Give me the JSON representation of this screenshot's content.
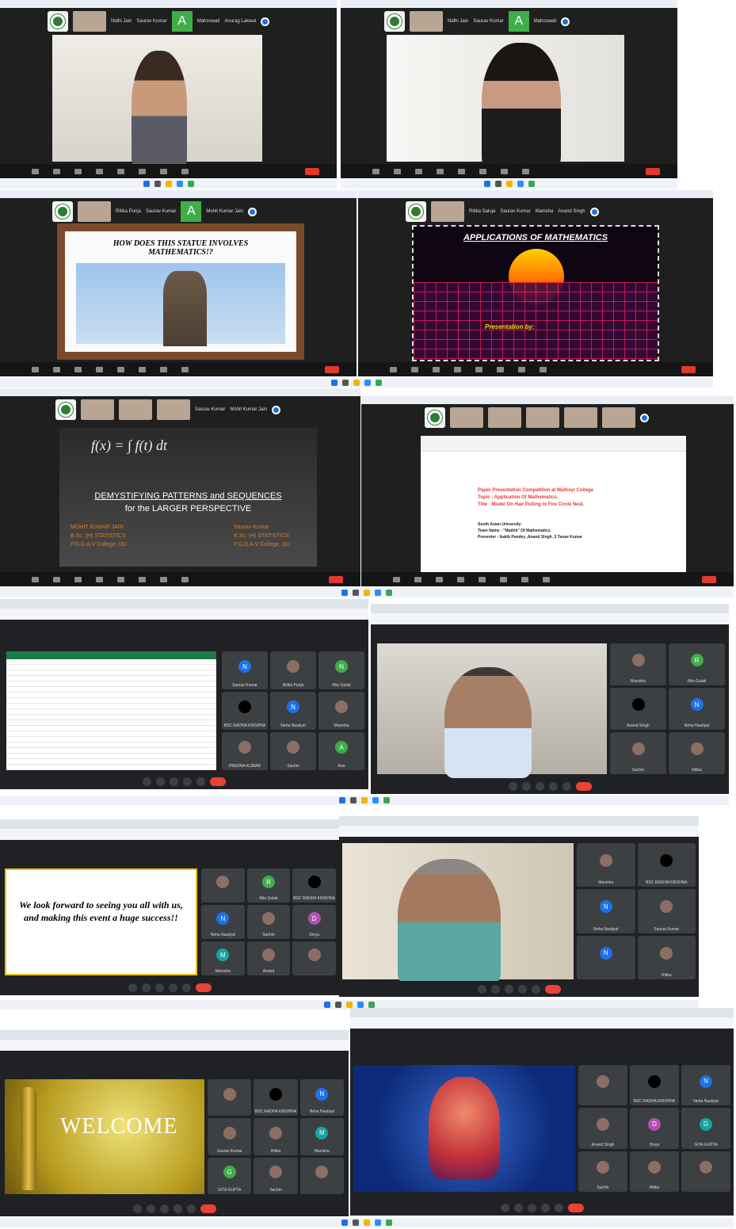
{
  "panel1": {
    "participants": [
      "Nidhi Jain",
      "Saurav Kumar",
      "A",
      "Mahoswati",
      "Anurag Lakwal"
    ]
  },
  "panel2": {
    "participants": [
      "Nidhi Jain",
      "Saurav Kumar",
      "A",
      "Mahoswati"
    ]
  },
  "panel3": {
    "participants": [
      "Ritika Punja",
      "Saurav Kumar",
      "A",
      "Mohit Kumar Jain"
    ],
    "slide": {
      "title": "HOW DOES THIS STATUE  INVOLVES MATHEMATICS!?"
    }
  },
  "panel4": {
    "participants": [
      "Ritika Saluja",
      "Saurav Kumar",
      "Manisha",
      "Anand Singh"
    ],
    "slide": {
      "title": "APPLICATIONS OF MATHEMATICS",
      "byline": "Presentation by:"
    }
  },
  "panel5": {
    "participants": [
      "Saurav Kumar",
      "Mohit Kumar Jain"
    ],
    "slide": {
      "formula": "f(x) = ∫ f(t) dt",
      "title1": "DEMYSTIFYING PATTERNS and SEQUENCES",
      "title2": "for the LARGER PERSPECTIVE",
      "left": [
        "MOHIT KUMAR JAIN",
        "B.Sc. (H) STATISTICS",
        "P.G.D.A.V College, DU"
      ],
      "right": [
        "Saurav Kumar",
        "B.Sc. (H) STATISTICS",
        "P.G.D.A.V College, DU"
      ]
    }
  },
  "panel6": {
    "doc": {
      "line1": "Paper Presentation Competition at Maitreyi College",
      "line2": "Topic :  Application Of Mathematics.",
      "line3": "Title :  Model On Hair Pulling to Fire Circle Nest.",
      "inst": "South Asian University",
      "team": "Team Name :  \"Mathik\" Of Mathematics.",
      "presenter": "Presenter :  Aakib Pandey ,Anand Singh ,3 Tanav Kumar"
    }
  },
  "panel7": {
    "tiles": [
      {
        "n": "N",
        "name": "Saurav Kumar",
        "c": "#1a73e8"
      },
      {
        "n": "",
        "name": "Ritika Punja",
        "c": ""
      },
      {
        "n": "N",
        "name": "Ritu Gulati",
        "c": "#3fae49"
      },
      {
        "n": "",
        "name": "BSC RADHA KRISHNA",
        "c": "#000"
      },
      {
        "n": "N",
        "name": "Neha Nautiyal",
        "c": "#1a73e8"
      },
      {
        "n": "",
        "name": "Manisha",
        "c": ""
      },
      {
        "n": "",
        "name": "PRERNA KUMAR",
        "c": ""
      },
      {
        "n": "",
        "name": "Sachin",
        "c": ""
      },
      {
        "n": "A",
        "name": "Anu",
        "c": "#3fae49"
      }
    ]
  },
  "panel8": {
    "tiles": [
      {
        "n": "",
        "name": "Manisha",
        "c": ""
      },
      {
        "n": "R",
        "name": "Ritu Gulati",
        "c": "#3fae49"
      },
      {
        "n": "",
        "name": "Anand Singh",
        "c": "#000"
      },
      {
        "n": "N",
        "name": "Neha Nautiyal",
        "c": "#1a73e8"
      },
      {
        "n": "",
        "name": "Sachin",
        "c": ""
      },
      {
        "n": "",
        "name": "Ritika",
        "c": ""
      }
    ]
  },
  "panel9": {
    "message": "We look forward to seeing you all with us, and making this event a huge success!!",
    "tiles": [
      {
        "n": "",
        "name": "",
        "c": ""
      },
      {
        "n": "R",
        "name": "Ritu Gulati",
        "c": "#3fae49"
      },
      {
        "n": "",
        "name": "BSC RADHA KRISHNA",
        "c": "#000"
      },
      {
        "n": "N",
        "name": "Neha Nautiyal",
        "c": "#1a73e8"
      },
      {
        "n": "",
        "name": "Sachin",
        "c": ""
      },
      {
        "n": "D",
        "name": "Divya",
        "c": "#b44fb4"
      },
      {
        "n": "M",
        "name": "Manisha",
        "c": "#19a3a3"
      },
      {
        "n": "",
        "name": "Anand",
        "c": ""
      },
      {
        "n": "",
        "name": "",
        "c": ""
      }
    ]
  },
  "panel10": {
    "tiles": [
      {
        "n": "",
        "name": "Manisha",
        "c": ""
      },
      {
        "n": "",
        "name": "BSC RADHA KRISHNA",
        "c": "#000"
      },
      {
        "n": "N",
        "name": "Neha Nautiyal",
        "c": "#1a73e8"
      },
      {
        "n": "",
        "name": "Saurav Kumar",
        "c": ""
      },
      {
        "n": "N",
        "name": "",
        "c": "#1a73e8"
      },
      {
        "n": "",
        "name": "Ritika",
        "c": ""
      }
    ]
  },
  "panel11": {
    "slide": {
      "title": "WELCOME"
    },
    "tiles": [
      {
        "n": "",
        "name": "",
        "c": ""
      },
      {
        "n": "",
        "name": "BSC RADHA KRISHNA",
        "c": "#000"
      },
      {
        "n": "N",
        "name": "Neha Nautiyal",
        "c": "#1a73e8"
      },
      {
        "n": "",
        "name": "Saurav Kumar",
        "c": ""
      },
      {
        "n": "",
        "name": "Ritika",
        "c": ""
      },
      {
        "n": "M",
        "name": "Manisha",
        "c": "#19a3a3"
      },
      {
        "n": "G",
        "name": "GITA GUPTA",
        "c": "#3fae49"
      },
      {
        "n": "",
        "name": "Sachin",
        "c": ""
      },
      {
        "n": "",
        "name": "",
        "c": ""
      }
    ]
  },
  "panel12": {
    "tiles": [
      {
        "n": "",
        "name": "",
        "c": ""
      },
      {
        "n": "",
        "name": "BSC RADHA KRISHNA",
        "c": "#000"
      },
      {
        "n": "N",
        "name": "Neha Nautiyal",
        "c": "#1a73e8"
      },
      {
        "n": "",
        "name": "Anand Singh",
        "c": ""
      },
      {
        "n": "D",
        "name": "Divya",
        "c": "#b44fb4"
      },
      {
        "n": "G",
        "name": "GITA GUPTA",
        "c": "#19a3a3"
      },
      {
        "n": "",
        "name": "Sachin",
        "c": ""
      },
      {
        "n": "",
        "name": "Ritika",
        "c": ""
      },
      {
        "n": "",
        "name": "",
        "c": ""
      }
    ]
  }
}
